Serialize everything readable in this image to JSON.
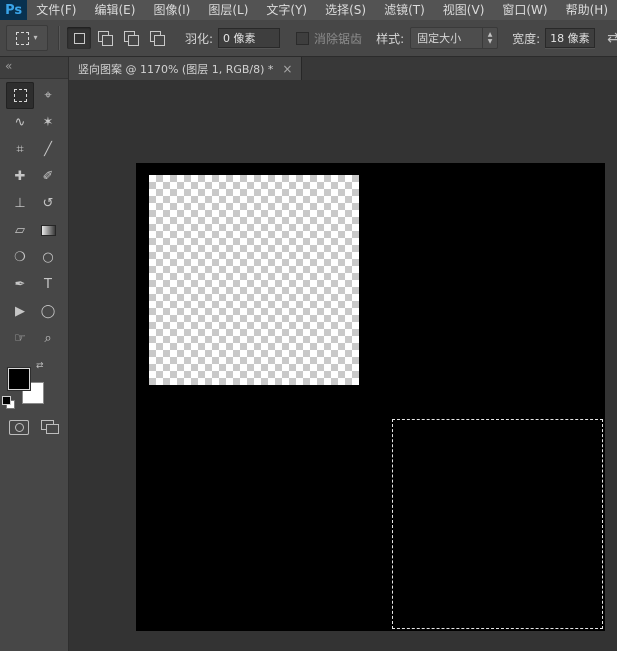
{
  "app": {
    "logo_text": "Ps"
  },
  "menubar": {
    "items": [
      "文件(F)",
      "编辑(E)",
      "图像(I)",
      "图层(L)",
      "文字(Y)",
      "选择(S)",
      "滤镜(T)",
      "视图(V)",
      "窗口(W)",
      "帮助(H)"
    ]
  },
  "options": {
    "feather_label": "羽化:",
    "feather_value": "0 像素",
    "antialias_label": "消除锯齿",
    "style_label": "样式:",
    "style_value": "固定大小",
    "width_label": "宽度:",
    "width_value": "18 像素"
  },
  "icons": {
    "dropdown_caret": "▾",
    "stepper_up": "▲",
    "stepper_down": "▼",
    "swap": "⇄",
    "swap_colors": "⇄",
    "collapse": "«",
    "close": "×"
  },
  "tabbar": {
    "active_tab": {
      "title": "竖向图案 @ 1170% (图层 1, RGB/8) *"
    }
  },
  "toolbar": {
    "tools": [
      {
        "name": "rectangular-marquee",
        "glyph": "",
        "selected": true
      },
      {
        "name": "move",
        "glyph": "⌖"
      },
      {
        "name": "lasso",
        "glyph": "∿"
      },
      {
        "name": "magic-wand",
        "glyph": "✶"
      },
      {
        "name": "crop",
        "glyph": "⌗"
      },
      {
        "name": "eyedropper",
        "glyph": "╱"
      },
      {
        "name": "healing-brush",
        "glyph": "✚"
      },
      {
        "name": "brush",
        "glyph": "✐"
      },
      {
        "name": "clone-stamp",
        "glyph": "⊥"
      },
      {
        "name": "history-brush",
        "glyph": "↺"
      },
      {
        "name": "eraser",
        "glyph": "▱"
      },
      {
        "name": "gradient",
        "glyph": ""
      },
      {
        "name": "blur",
        "glyph": "❍"
      },
      {
        "name": "dodge",
        "glyph": "○"
      },
      {
        "name": "pen",
        "glyph": "✒"
      },
      {
        "name": "type",
        "glyph": "T"
      },
      {
        "name": "path-selection",
        "glyph": "▶"
      },
      {
        "name": "ellipse-shape",
        "glyph": "◯"
      },
      {
        "name": "hand",
        "glyph": "☞"
      },
      {
        "name": "zoom",
        "glyph": "⌕"
      }
    ],
    "foreground_color": "#000000",
    "background_color": "#ffffff"
  },
  "colors": {
    "ui_panel": "#474747",
    "ui_menubar": "#535353",
    "pasteboard": "#333333",
    "canvas": "#000000",
    "logo_blue": "#3aa5e9"
  }
}
